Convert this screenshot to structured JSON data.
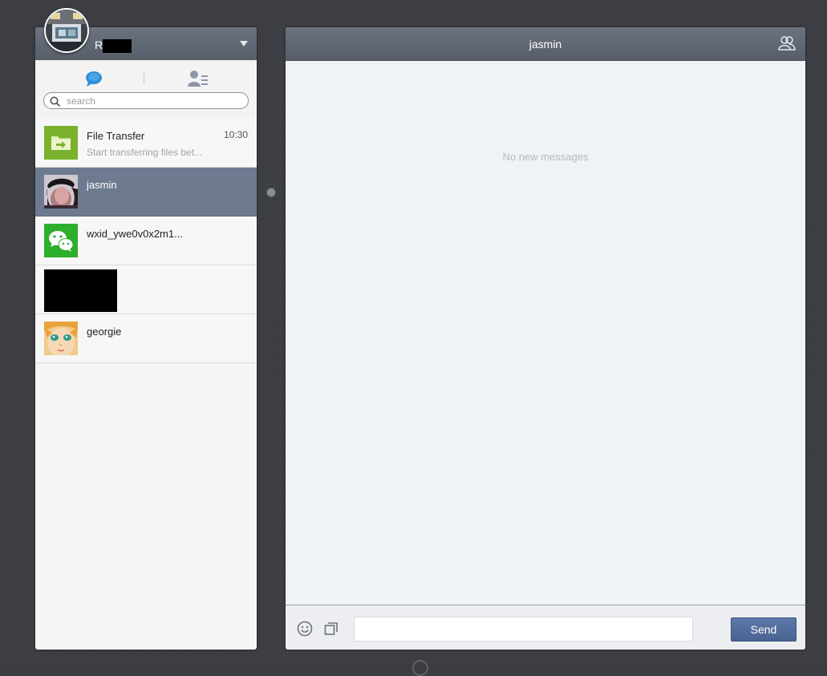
{
  "profile": {
    "name": "R",
    "avatar_icon": "user-photo-avatar"
  },
  "tabs": {
    "chats_icon": "chat-bubble-icon",
    "contacts_icon": "contacts-icon"
  },
  "search": {
    "placeholder": "search",
    "value": ""
  },
  "chats": [
    {
      "name": "File Transfer",
      "preview": "Start transferring files bet...",
      "time": "10:30",
      "avatar": "file-transfer-folder-icon",
      "active": false
    },
    {
      "name": "jasmin",
      "preview": "",
      "time": "",
      "avatar": "user-photo-avatar",
      "active": true
    },
    {
      "name": "wxid_ywe0v0x2m1...",
      "preview": "",
      "time": "",
      "avatar": "wechat-logo-icon",
      "active": false
    },
    {
      "name": "",
      "preview": "",
      "time": "",
      "avatar": "redacted",
      "active": false
    },
    {
      "name": "georgie",
      "preview": "",
      "time": "",
      "avatar": "anime-face-avatar",
      "active": false
    }
  ],
  "conversation": {
    "title": "jasmin",
    "members_icon": "members-icon",
    "empty_text": "No new messages"
  },
  "composer": {
    "emoji_icon": "smiley-icon",
    "screenshot_icon": "screenshot-icon",
    "input_value": "",
    "send_label": "Send"
  },
  "colors": {
    "header": "#626a77",
    "active_row": "#6e7a8f",
    "send_button": "#5670a0",
    "file_transfer_green": "#7ab22e",
    "wechat_green": "#2dae2d"
  }
}
